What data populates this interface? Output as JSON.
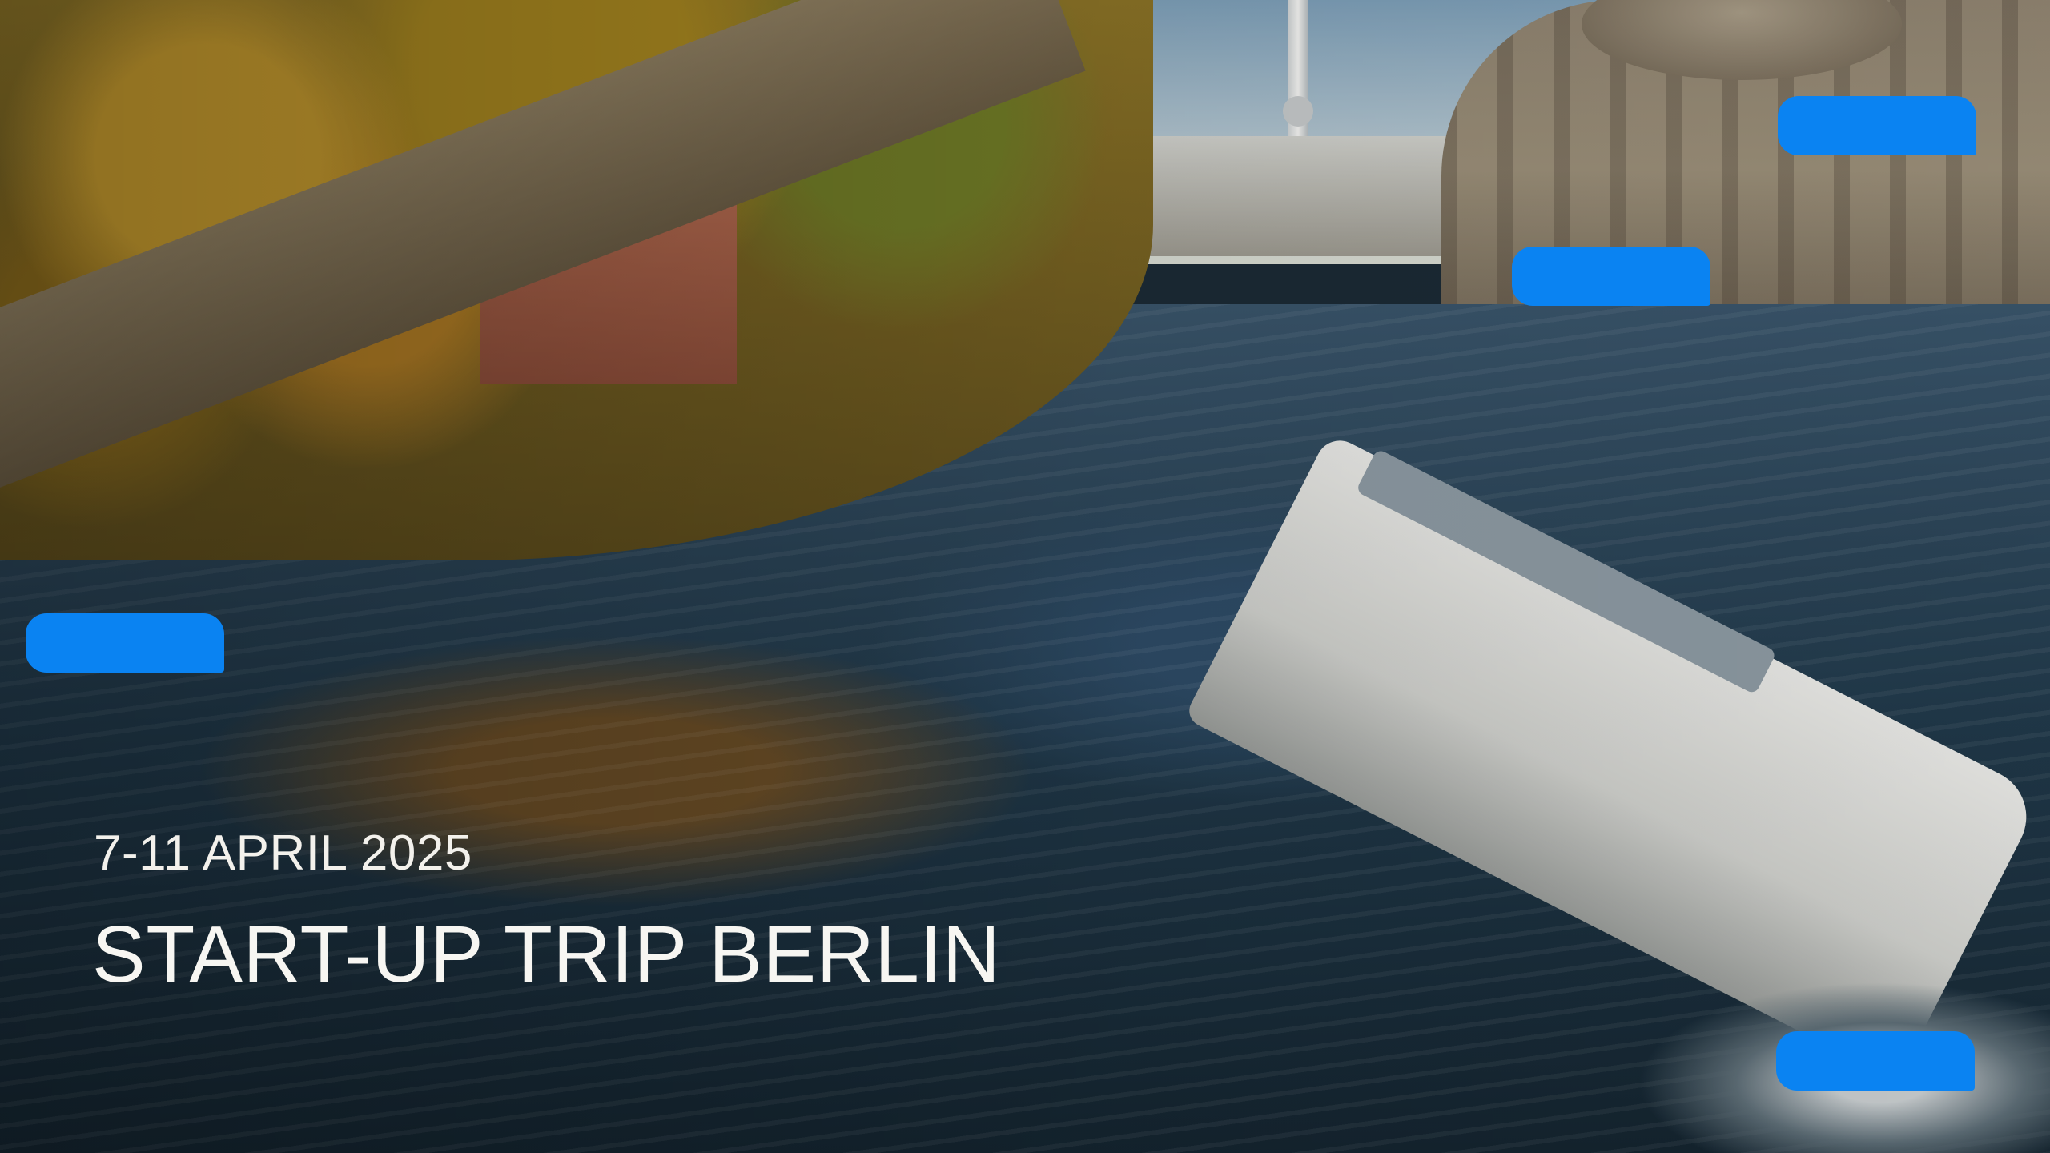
{
  "slide": {
    "date": "7-11 APRIL 2025",
    "title": "START-UP TRIP BERLIN"
  },
  "colors": {
    "accent": "#0a83f2",
    "text": "#f3f1ec"
  }
}
